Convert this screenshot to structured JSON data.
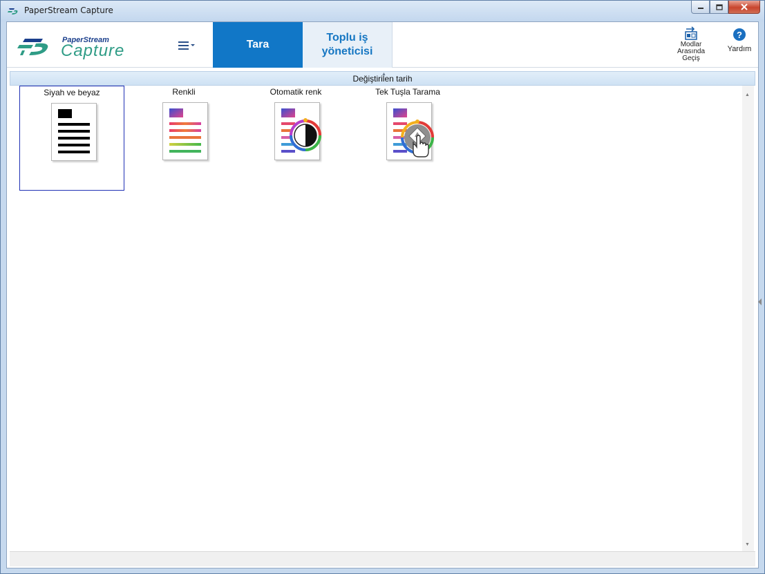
{
  "window": {
    "title": "PaperStream Capture"
  },
  "header": {
    "logo_small": "PaperStream",
    "logo_big": "Capture",
    "tabs": [
      {
        "label_line1": "Tara",
        "label_line2": "",
        "active": true
      },
      {
        "label_line1": "Toplu iş",
        "label_line2": "yöneticisi",
        "active": false
      }
    ],
    "switch_modes": {
      "line1": "Modlar",
      "line2": "Arasında",
      "line3": "Geçiş"
    },
    "help_label": "Yardım"
  },
  "sortbar": {
    "label": "Değiştirilen tarih"
  },
  "profiles": [
    {
      "label": "Siyah ve beyaz",
      "icon": "black-white-document-icon",
      "selected": true
    },
    {
      "label": "Renkli",
      "icon": "color-document-icon",
      "selected": false
    },
    {
      "label": "Otomatik renk",
      "icon": "auto-color-document-icon",
      "selected": false
    },
    {
      "label": "Tek Tuşla Tarama",
      "icon": "one-touch-scan-document-icon",
      "selected": false
    }
  ],
  "colors": {
    "active_tab": "#1177c7",
    "inactive_tab_text": "#1576c2",
    "selection_border": "#1e2fb4"
  }
}
